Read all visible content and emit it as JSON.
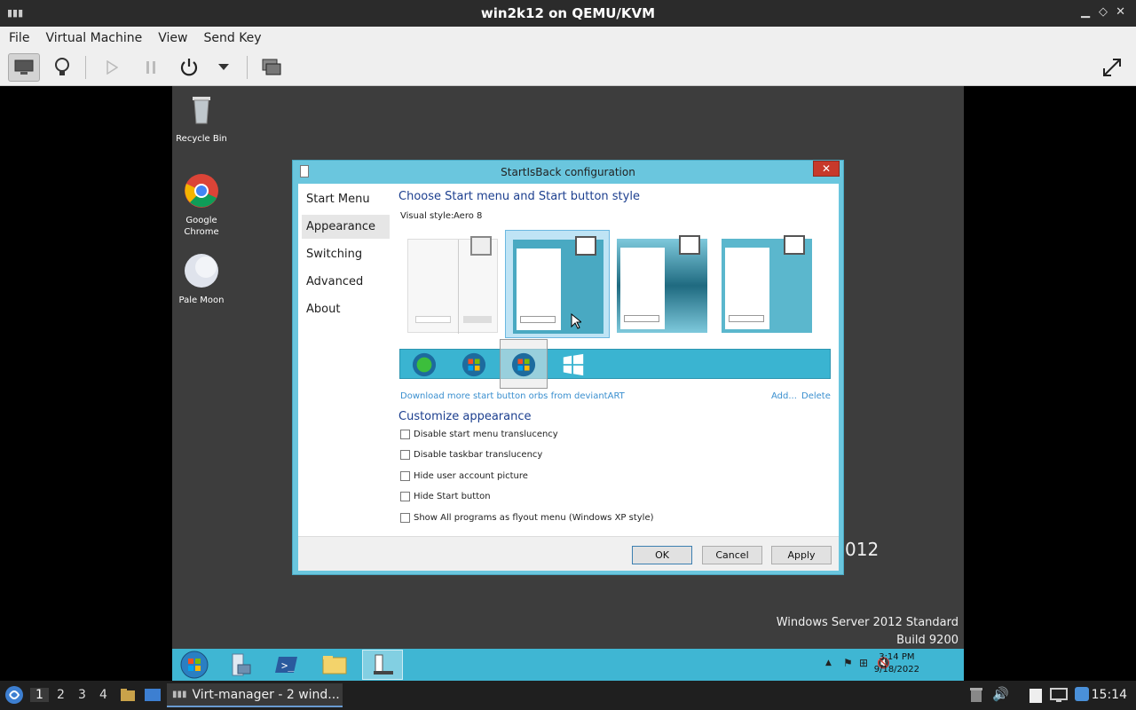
{
  "window": {
    "title": "win2k12 on QEMU/KVM"
  },
  "menu": {
    "file": "File",
    "vm": "Virtual Machine",
    "view": "View",
    "sendkey": "Send Key"
  },
  "desktop": {
    "icons": [
      {
        "label1": "Recycle Bin",
        "label2": ""
      },
      {
        "label1": "Google",
        "label2": "Chrome"
      },
      {
        "label1": "Pale Moon",
        "label2": ""
      }
    ],
    "edition": "Windows Server 2012 Standard",
    "build": "Build 9200",
    "bg_fragment": "012"
  },
  "dialog": {
    "title": "StartIsBack configuration",
    "close": "✕",
    "nav": [
      "Start Menu",
      "Appearance",
      "Switching",
      "Advanced",
      "About"
    ],
    "selected_nav": "Appearance",
    "heading": "Choose Start menu and Start button style",
    "visual_style_label": "Visual style:",
    "visual_style_value": "Aero 8",
    "download_link": "Download more start button orbs from deviantART",
    "add_link": "Add...",
    "delete_link": "Delete",
    "customize_heading": "Customize appearance",
    "options": [
      "Disable start menu translucency",
      "Disable taskbar translucency",
      "Hide user account picture",
      "Hide Start button",
      "Show All programs as flyout menu (Windows XP style)"
    ],
    "buttons": {
      "ok": "OK",
      "cancel": "Cancel",
      "apply": "Apply"
    }
  },
  "vm_taskbar": {
    "time": "3:14 PM",
    "date": "9/18/2022"
  },
  "host_panel": {
    "workspaces": [
      "1",
      "2",
      "3",
      "4"
    ],
    "task": "Virt-manager - 2 wind...",
    "clock": "15:14"
  },
  "colors": {
    "accent": "#3fb6d3",
    "desktop": "#3d3d3d",
    "close": "#c7392b"
  }
}
